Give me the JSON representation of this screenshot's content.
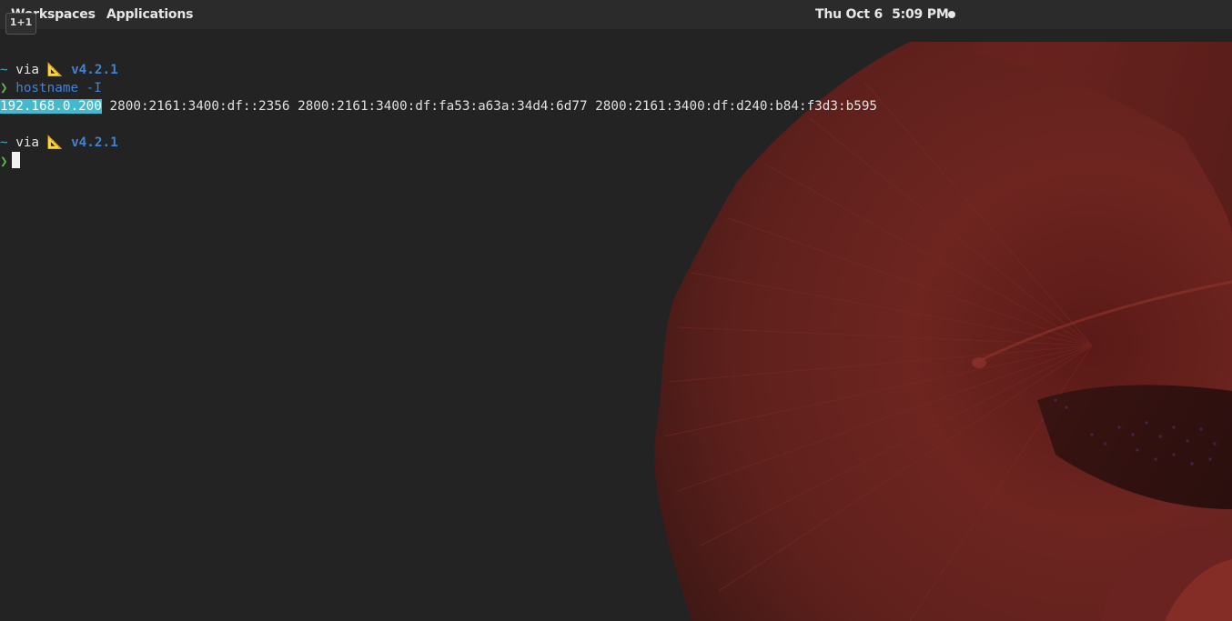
{
  "top_panel": {
    "workspaces_label": "Workspaces",
    "applications_label": "Applications",
    "clock_date": "Thu Oct 6",
    "clock_time": "5:09 PM",
    "workspace_indicator": "1+1"
  },
  "terminal": {
    "prompt_1": {
      "tilde": "~",
      "via": "via",
      "icon": "triangular-ruler-icon",
      "version": "v4.2.1"
    },
    "command_line": {
      "arrow": "❯",
      "command": "hostname -I"
    },
    "output": {
      "selected_ip": "192.168.0.200",
      "rest": " 2800:2161:3400:df::2356 2800:2161:3400:df:fa53:a63a:34d4:6d77 2800:2161:3400:df:d240:b84:f3d3:b595"
    },
    "prompt_2": {
      "tilde": "~",
      "via": "via",
      "icon": "triangular-ruler-icon",
      "version": "v4.2.1"
    },
    "input_line": {
      "arrow": "❯"
    }
  },
  "colors": {
    "terminal_bg": "#232323",
    "panel_bg": "#2b2b2b",
    "prompt_arrow": "#5fb54a",
    "version_blue": "#3f82d4",
    "tilde_cyan": "#3aa9c9",
    "selection_bg": "#45b8cb",
    "wallpaper_red": "#6b2420"
  }
}
